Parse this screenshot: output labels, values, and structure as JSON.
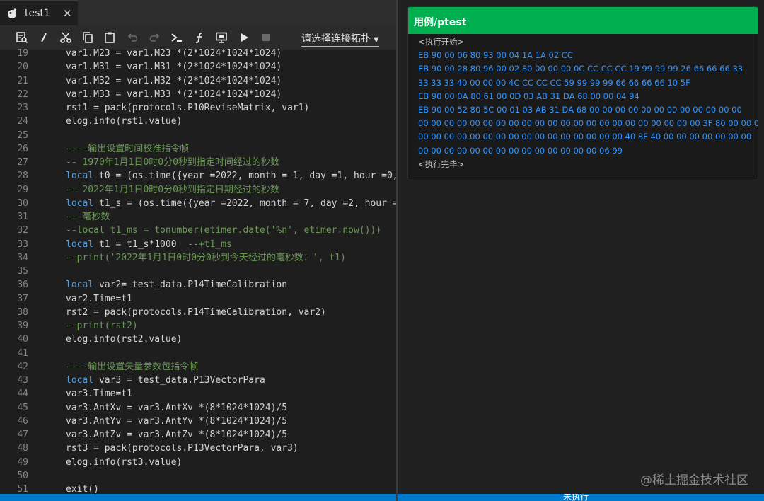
{
  "tab": {
    "title": "test1",
    "close_glyph": "✕",
    "icon": "bomb-icon"
  },
  "toolbar": {
    "buttons": [
      {
        "name": "search-file-icon"
      },
      {
        "name": "comment-slash-icon"
      },
      {
        "name": "cut-icon"
      },
      {
        "name": "copy-icon"
      },
      {
        "name": "paste-icon"
      },
      {
        "name": "undo-icon",
        "disabled": true
      },
      {
        "name": "redo-icon",
        "disabled": true
      },
      {
        "name": "terminal-icon"
      },
      {
        "name": "function-icon"
      },
      {
        "name": "monitor-icon"
      },
      {
        "name": "run-icon"
      },
      {
        "name": "stop-icon",
        "disabled": true
      }
    ],
    "connection_select": "请选择连接拓扑"
  },
  "code_lines": [
    {
      "n": "19",
      "t": "var1.M23 = var1.M23 *(2*1024*1024*1024)"
    },
    {
      "n": "20",
      "t": "var1.M31 = var1.M31 *(2*1024*1024*1024)"
    },
    {
      "n": "21",
      "t": "var1.M32 = var1.M32 *(2*1024*1024*1024)"
    },
    {
      "n": "22",
      "t": "var1.M33 = var1.M33 *(2*1024*1024*1024)"
    },
    {
      "n": "23",
      "t": "rst1 = pack(protocols.P10ReviseMatrix, var1)"
    },
    {
      "n": "24",
      "t": "elog.info(rst1.value)"
    },
    {
      "n": "25",
      "t": ""
    },
    {
      "n": "26",
      "t": "----输出设置时间校准指令帧",
      "c": 1
    },
    {
      "n": "27",
      "t": "-- 1970年1月1日0时0分0秒到指定时间经过的秒数",
      "c": 1
    },
    {
      "n": "28",
      "t": "local t0 = (os.time({year =2022, month = 1, day =1, hour =0,",
      "k": 1
    },
    {
      "n": "29",
      "t": "-- 2022年1月1日0时0分0秒到指定日期经过的秒数",
      "c": 1
    },
    {
      "n": "30",
      "t": "local t1_s = (os.time({year =2022, month = 7, day =2, hour =8",
      "k": 1
    },
    {
      "n": "31",
      "t": "-- 毫秒数",
      "c": 1
    },
    {
      "n": "32",
      "t": "--local t1_ms = tonumber(etimer.date('%n', etimer.now()))",
      "c": 1
    },
    {
      "n": "33",
      "t": "local t1 = t1_s*1000  ",
      "k": 1,
      "tail": "--+t1_ms"
    },
    {
      "n": "34",
      "t": "--print('2022年1月1日0时0分0秒到今天经过的毫秒数：', t1)",
      "c": 1
    },
    {
      "n": "35",
      "t": ""
    },
    {
      "n": "36",
      "t": "local var2= test_data.P14TimeCalibration",
      "k": 1
    },
    {
      "n": "37",
      "t": "var2.Time=t1"
    },
    {
      "n": "38",
      "t": "rst2 = pack(protocols.P14TimeCalibration, var2)"
    },
    {
      "n": "39",
      "t": "--print(rst2)",
      "c": 1
    },
    {
      "n": "40",
      "t": "elog.info(rst2.value)"
    },
    {
      "n": "41",
      "t": ""
    },
    {
      "n": "42",
      "t": "----输出设置矢量参数包指令帧",
      "c": 1
    },
    {
      "n": "43",
      "t": "local var3 = test_data.P13VectorPara",
      "k": 1
    },
    {
      "n": "44",
      "t": "var3.Time=t1"
    },
    {
      "n": "45",
      "t": "var3.AntXv = var3.AntXv *(8*1024*1024)/5"
    },
    {
      "n": "46",
      "t": "var3.AntYv = var3.AntYv *(8*1024*1024)/5"
    },
    {
      "n": "47",
      "t": "var3.AntZv = var3.AntZv *(8*1024*1024)/5"
    },
    {
      "n": "48",
      "t": "rst3 = pack(protocols.P13VectorPara, var3)"
    },
    {
      "n": "49",
      "t": "elog.info(rst3.value)"
    },
    {
      "n": "50",
      "t": ""
    },
    {
      "n": "51",
      "t": "exit()"
    }
  ],
  "output_panel": {
    "title": "用例/ptest",
    "lines": [
      {
        "t": "<执行开始>",
        "s": 1
      },
      {
        "t": "EB 90 00 06 80 93 00 04 1A 1A 02 CC"
      },
      {
        "t": "EB 90 00 28 80 96 00 02 80 00 00 00 0C CC CC CC 19 99 99 99 26 66 66 66 33"
      },
      {
        "t": "33 33 33 40 00 00 00 4C CC CC CC 59 99 99 99 66 66 66 66 10 5F"
      },
      {
        "t": "EB 90 00 0A 80 61 00 0D 03 AB 31 DA 68 00 00 04 94"
      },
      {
        "t": "EB 90 00 52 80 5C 00 01 03 AB 31 DA 68 00 00 00 00 00 00 00 00 00 00 00 00"
      },
      {
        "t": "00 00 00 00 00 00 00 00 00 00 00 00 00 00 00 00 00 00 00 00 00 00 3F 80 00 00 00"
      },
      {
        "t": "00 00 00 00 00 00 00 00 00 00 00 00 00 00 00 00 40 8F 40 00 00 00 00 00 00 00"
      },
      {
        "t": "00 00 00 00 00 00 00 00 00 00 00 00 00 00 06 99"
      },
      {
        "t": "<执行完毕>",
        "s": 1
      }
    ]
  },
  "status_right": {
    "label": "未执行"
  },
  "watermark": "@稀土掘金技术社区",
  "colors": {
    "accent_green": "#00b050",
    "hex_blue": "#2f93ff",
    "status_blue": "#007acc"
  }
}
